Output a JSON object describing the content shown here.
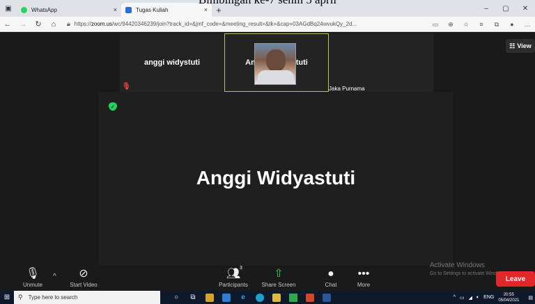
{
  "caption": "Bimbingan ke-7 senin 5 april",
  "browser": {
    "tabs": [
      {
        "label": "WhatsApp",
        "favicon_color": "#25D366",
        "close": "×"
      },
      {
        "label": "Tugas Kuliah",
        "favicon_color": "#2d6cdf",
        "close": "×"
      }
    ],
    "new_tab": "+",
    "url_prefix": "https://",
    "url_host": "zoom.us",
    "url_rest": "/wc/94420346239/join?track_id=&jmf_code=&meeting_result=&tk=&cap=03AGdBq24wvukQy_2d..."
  },
  "zoom": {
    "tiles": [
      {
        "name": "anggi widystuti",
        "muted": true
      },
      {
        "name": "Anggi Widyastuti",
        "speaking": true
      },
      {
        "name": "Jaka Purnama"
      }
    ],
    "view_label": "View",
    "main_name": "Anggi Widyastuti",
    "toolbar": {
      "unmute": "Unmute",
      "start_video": "Start Video",
      "participants": "Participants",
      "participants_count": "3",
      "share_screen": "Share Screen",
      "chat": "Chat",
      "more": "More",
      "leave": "Leave"
    },
    "activate": {
      "title": "Activate Windows",
      "sub": "Go to Settings to activate Windows."
    }
  },
  "taskbar": {
    "search_placeholder": "Type here to search",
    "lang": "ENG",
    "time": "20:55",
    "date": "05/04/2021"
  },
  "colors": {
    "leave": "#e02828",
    "share_green": "#2ad16b",
    "speaking_border": "#b8c468",
    "muted_red": "#e8433a"
  }
}
